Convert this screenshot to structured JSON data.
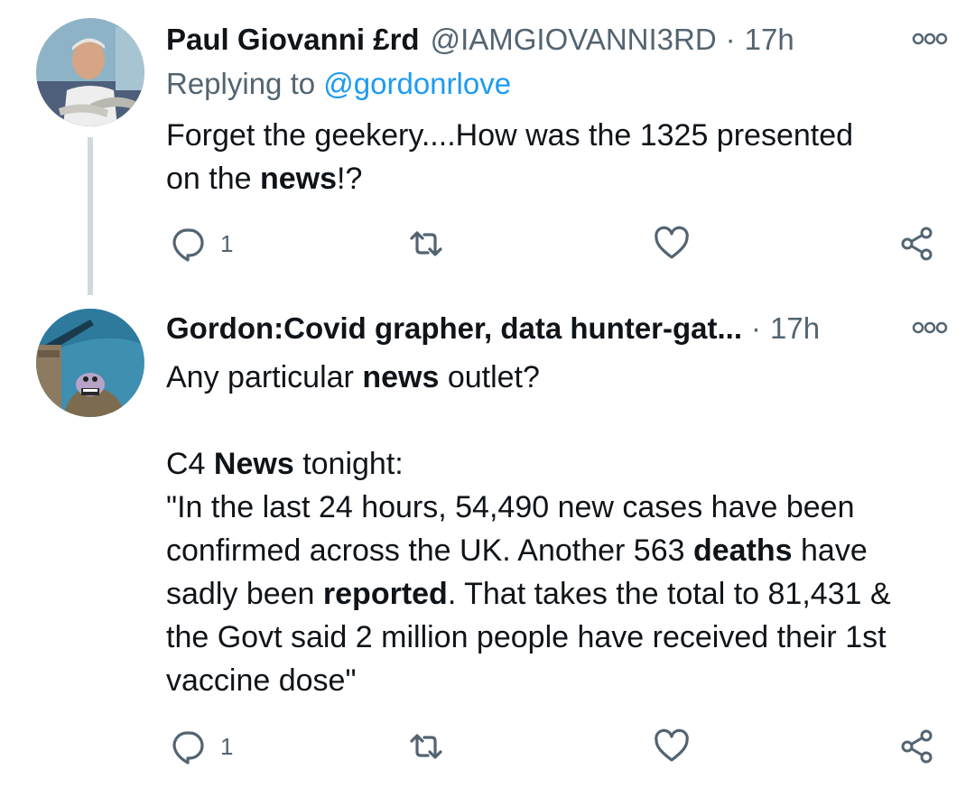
{
  "tweets": [
    {
      "name": "Paul Giovanni £rd",
      "handle": "@IAMGIOVANNI3RD",
      "separator": "·",
      "time": "17h",
      "replying_prefix": "Replying to",
      "replying_to": "@gordonrlove",
      "text_parts": [
        "Forget the geekery....How was the 1325 presented\non the ",
        "news",
        "!?"
      ],
      "reply_count": "1",
      "icons": {
        "avatar": "avatar-fishmonger",
        "more": "more-icon",
        "reply": "reply-icon",
        "retweet": "retweet-icon",
        "like": "heart-icon",
        "share": "share-icon"
      }
    },
    {
      "name": "Gordon:Covid grapher, data hunter-gat...",
      "separator": "·",
      "time": "17h",
      "text_parts": [
        "Any particular ",
        "news",
        " outlet?\n\nC4 ",
        "News",
        " tonight:\n\"In the last 24 hours, 54,490 new cases have been\nconfirmed across the UK. Another 563 ",
        "deaths",
        " have\nsadly been ",
        "reported",
        ". That takes the total to 81,431 &\nthe Govt said 2 million people have received their 1st\nvaccine dose\""
      ],
      "reply_count": "1",
      "icons": {
        "avatar": "avatar-cartoon",
        "more": "more-icon",
        "reply": "reply-icon",
        "retweet": "retweet-icon",
        "like": "heart-icon",
        "share": "share-icon"
      }
    }
  ],
  "colors": {
    "link": "#1d9bf0",
    "secondary": "#536471",
    "text": "#0f1419",
    "thread_line": "#cfd9de"
  }
}
